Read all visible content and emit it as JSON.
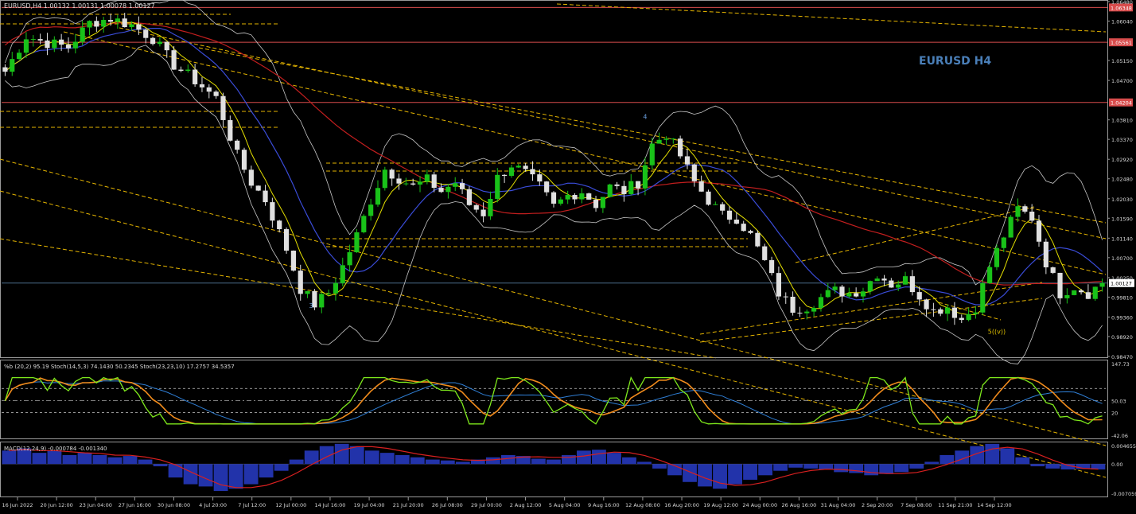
{
  "chart_data": {
    "type": "candlestick",
    "symbol_info": "EURUSD,H4  1.00132 1.00131 1.00078 1.00127",
    "watermark": "EURUSD H4",
    "price_axis": {
      "ticks": [
        "1.06480",
        "1.06040",
        "1.05150",
        "1.04700",
        "1.03810",
        "1.03370",
        "1.02920",
        "1.02480",
        "1.02030",
        "1.01590",
        "1.01140",
        "1.00700",
        "1.00250",
        "0.99810",
        "0.99360",
        "0.98920",
        "0.98470"
      ],
      "ylim": [
        0.9847,
        1.0648
      ]
    },
    "horizontal_levels": [
      {
        "label": "1.06348",
        "value": 1.06348,
        "color": "#d84c4c"
      },
      {
        "label": "1.05561",
        "value": 1.05561,
        "color": "#d84c4c"
      },
      {
        "label": "1.04204",
        "value": 1.04204,
        "color": "#d84c4c"
      },
      {
        "label": "1.00127",
        "value": 1.00127,
        "color": "#4a6c8a"
      }
    ],
    "current_price": "1.00127",
    "wave_labels": [
      {
        "text": "3",
        "x": 43.5,
        "y": 0.9957
      },
      {
        "text": "4",
        "x": 91,
        "y": 1.0383
      },
      {
        "text": "5((v))",
        "x": 141,
        "y": 0.9898
      }
    ],
    "price_path": [
      [
        0,
        1.049
      ],
      [
        3,
        1.057
      ],
      [
        6,
        1.0555
      ],
      [
        9,
        1.0545
      ],
      [
        12,
        1.06
      ],
      [
        15,
        1.061
      ],
      [
        18,
        1.0595
      ],
      [
        21,
        1.0565
      ],
      [
        24,
        1.0505
      ],
      [
        27,
        1.047
      ],
      [
        30,
        1.043
      ],
      [
        33,
        1.03
      ],
      [
        35,
        1.024
      ],
      [
        37,
        1.02
      ],
      [
        40,
        1.009
      ],
      [
        42,
        1.0
      ],
      [
        44,
        0.9965
      ],
      [
        46,
        0.999
      ],
      [
        48,
        1.005
      ],
      [
        50,
        1.012
      ],
      [
        52,
        1.02
      ],
      [
        54,
        1.027
      ],
      [
        56,
        1.025
      ],
      [
        58,
        1.023
      ],
      [
        60,
        1.0245
      ],
      [
        62,
        1.022
      ],
      [
        64,
        1.024
      ],
      [
        66,
        1.019
      ],
      [
        68,
        1.017
      ],
      [
        70,
        1.025
      ],
      [
        72,
        1.028
      ],
      [
        74,
        1.026
      ],
      [
        76,
        1.023
      ],
      [
        78,
        1.0185
      ],
      [
        80,
        1.021
      ],
      [
        82,
        1.022
      ],
      [
        84,
        1.019
      ],
      [
        86,
        1.023
      ],
      [
        88,
        1.022
      ],
      [
        90,
        1.024
      ],
      [
        92,
        1.0325
      ],
      [
        94,
        1.035
      ],
      [
        96,
        1.03
      ],
      [
        98,
        1.024
      ],
      [
        100,
        1.02
      ],
      [
        102,
        1.0165
      ],
      [
        104,
        1.016
      ],
      [
        106,
        1.012
      ],
      [
        108,
        1.006
      ],
      [
        110,
        0.999
      ],
      [
        112,
        0.9955
      ],
      [
        114,
        0.996
      ],
      [
        116,
        0.998
      ],
      [
        118,
        0.9995
      ],
      [
        120,
        0.999
      ],
      [
        122,
        1.0
      ],
      [
        124,
        1.0035
      ],
      [
        126,
        1.001
      ],
      [
        128,
        1.002
      ],
      [
        130,
        0.9985
      ],
      [
        132,
        0.995
      ],
      [
        134,
        0.996
      ],
      [
        136,
        0.993
      ],
      [
        138,
        0.996
      ],
      [
        140,
        1.005
      ],
      [
        142,
        1.012
      ],
      [
        144,
        1.018
      ],
      [
        146,
        1.016
      ],
      [
        148,
        1.006
      ],
      [
        150,
        0.999
      ],
      [
        152,
        1.0005
      ],
      [
        154,
        0.999
      ],
      [
        156,
        1.0013
      ]
    ],
    "x_labels": [
      "16 Jun 2022",
      "20 Jun 12:00",
      "23 Jun 04:00",
      "27 Jun 16:00",
      "30 Jun 08:00",
      "4 Jul 20:00",
      "7 Jul 12:00",
      "12 Jul 00:00",
      "14 Jul 16:00",
      "19 Jul 04:00",
      "21 Jul 20:00",
      "26 Jul 08:00",
      "29 Jul 00:00",
      "2 Aug 12:00",
      "5 Aug 04:00",
      "9 Aug 16:00",
      "12 Aug 08:00",
      "16 Aug 20:00",
      "19 Aug 12:00",
      "24 Aug 00:00",
      "26 Aug 16:00",
      "31 Aug 04:00",
      "2 Sep 20:00",
      "7 Sep 08:00",
      "11 Sep 21:00",
      "14 Sep 12:00"
    ],
    "stochastic": {
      "label": "%b (20,2) 95.19  Stoch(14,5,3) 74.1430 50.2345  Stoch(23,23,10) 17.2757 34.5357",
      "axis_ticks": [
        "147.73",
        "50.03",
        "20",
        "-42.06"
      ],
      "ylim": [
        -42.06,
        147.73
      ],
      "levels": [
        80,
        50.03,
        20
      ]
    },
    "macd": {
      "label": "MACD(12,24,9) -0.000784 -0.001340",
      "axis_ticks": [
        "0.004655",
        "0.00",
        "-0.007059"
      ],
      "ylim": [
        -0.007059,
        0.004655
      ],
      "values": [
        0.003,
        0.0035,
        0.0025,
        0.003,
        0.002,
        0.0025,
        0.002,
        0.0015,
        0.0018,
        0.001,
        -0.0005,
        -0.003,
        -0.0045,
        -0.005,
        -0.006,
        -0.0055,
        -0.0045,
        -0.003,
        -0.0015,
        0.001,
        0.003,
        0.004,
        0.0045,
        0.004,
        0.003,
        0.0025,
        0.002,
        0.0015,
        0.001,
        0.0008,
        0.0005,
        0.001,
        0.0015,
        0.002,
        0.0018,
        0.0012,
        0.001,
        0.002,
        0.003,
        0.0032,
        0.0025,
        0.0015,
        0.0005,
        -0.001,
        -0.0025,
        -0.004,
        -0.005,
        -0.0055,
        -0.0045,
        -0.0035,
        -0.0025,
        -0.0015,
        -0.0008,
        -0.001,
        -0.0012,
        -0.0018,
        -0.002,
        -0.0025,
        -0.0022,
        -0.0018,
        -0.001,
        0.0005,
        0.002,
        0.003,
        0.004,
        0.0045,
        0.0035,
        0.0015,
        -0.0005,
        -0.001,
        -0.0012,
        -0.0011,
        -0.0012
      ]
    },
    "colors": {
      "background": "#000000",
      "bull_candle": "#19c219",
      "bear_candle": "#e0e0e0",
      "ma_fast": "#e5e000",
      "ma_mid": "#3a4cd8",
      "ma_slow": "#c21e1e",
      "bands": "#c8c8c8",
      "trendline": "#e4b400",
      "watermark": "#4a7fb8",
      "stoch_fast": "#7ee81c",
      "stoch_slow": "#f28c1c",
      "stoch_blue": "#2f7fd6",
      "macd_hist": "#2233aa",
      "macd_signal": "#d82020"
    }
  }
}
